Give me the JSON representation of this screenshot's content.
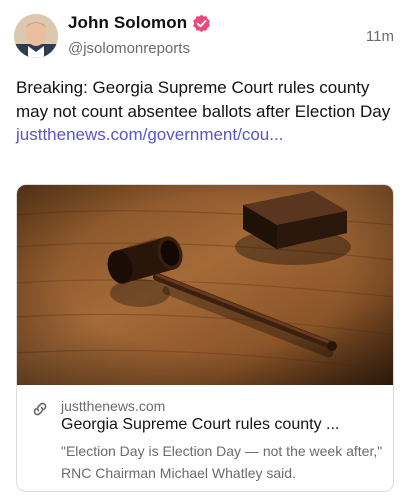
{
  "post": {
    "author": {
      "display_name": "John Solomon",
      "handle": "@jsolomonreports",
      "verified_badge_icon": "verified-badge-icon",
      "badge_color": "#e8487d"
    },
    "timestamp": "11m",
    "text": "Breaking: Georgia Supreme Court rules county may not count absentee ballots after Election Day ",
    "link_text": "justthenews.com/government/cou...",
    "link_color": "#5a55c8"
  },
  "link_card": {
    "image_description_icon": "gavel-photo",
    "link_icon": "link-icon",
    "domain": "justthenews.com",
    "title": "Georgia Supreme Court rules county ...",
    "description": "\"Election Day is Election Day — not the week after,\" RNC Chairman Michael Whatley said."
  }
}
